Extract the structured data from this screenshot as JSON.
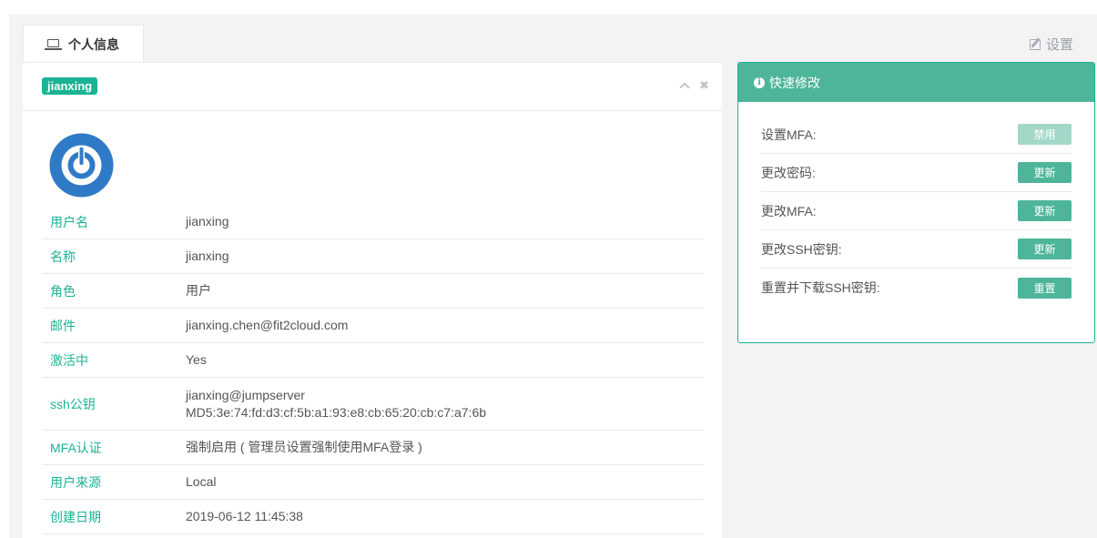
{
  "tabs": {
    "active_label": "个人信息",
    "settings_label": "设置"
  },
  "profile": {
    "badge": "jianxing",
    "fields": [
      {
        "label": "用户名",
        "value": "jianxing"
      },
      {
        "label": "名称",
        "value": "jianxing"
      },
      {
        "label": "角色",
        "value": "用户"
      },
      {
        "label": "邮件",
        "value": "jianxing.chen@fit2cloud.com"
      },
      {
        "label": "激活中",
        "value": "Yes"
      },
      {
        "label": "ssh公钥",
        "value": "jianxing@jumpserver",
        "value2": "MD5:3e:74:fd:d3:cf:5b:a1:93:e8:cb:65:20:cb:c7:a7:6b"
      },
      {
        "label": "MFA认证",
        "value": "强制启用 ( 管理员设置强制使用MFA登录 )"
      },
      {
        "label": "用户来源",
        "value": "Local"
      },
      {
        "label": "创建日期",
        "value": "2019-06-12 11:45:38"
      }
    ]
  },
  "quick": {
    "title": "快速修改",
    "items": [
      {
        "label": "设置MFA:",
        "button": "禁用"
      },
      {
        "label": "更改密码:",
        "button": "更新"
      },
      {
        "label": "更改MFA:",
        "button": "更新"
      },
      {
        "label": "更改SSH密钥:",
        "button": "更新"
      },
      {
        "label": "重置并下载SSH密钥:",
        "button": "重置"
      }
    ]
  },
  "colors": {
    "accent": "#1ab394",
    "header_green": "#4eb59a",
    "disabled_btn": "#a3d8c9",
    "avatar_blue": "#2f7ac6"
  }
}
